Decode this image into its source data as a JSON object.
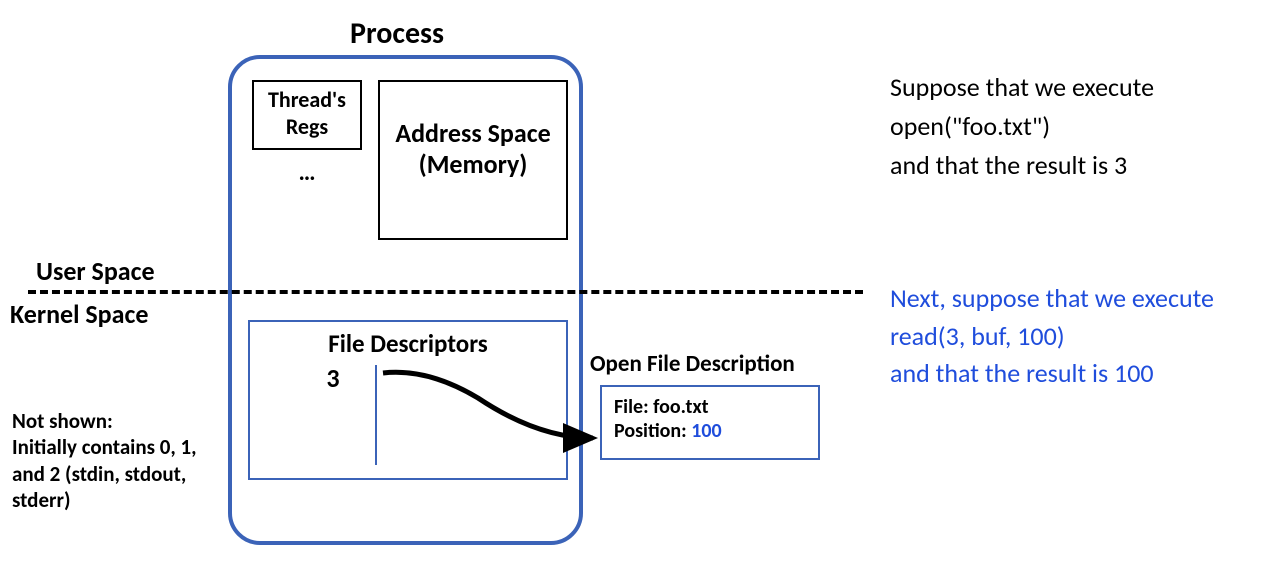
{
  "title": "Process",
  "labels": {
    "user_space": "User Space",
    "kernel_space": "Kernel Space",
    "thread_regs": "Thread's Regs",
    "thread_more": "…",
    "addr_space": "Address Space (Memory)",
    "file_descriptors": "File Descriptors",
    "fd_number": "3",
    "ofd_title": "Open File Description",
    "ofd_file_label": "File: ",
    "ofd_file_value": "foo.txt",
    "ofd_pos_label": "Position: ",
    "ofd_pos_value": "100"
  },
  "note": "Not shown:\nInitially contains 0, 1, and 2 (stdin, stdout, stderr)",
  "side1_line1": "Suppose that we execute",
  "side1_line2": "open(\"foo.txt\")",
  "side1_line3": "and that the result is 3",
  "side2_line1": "Next, suppose that we execute",
  "side2_line2": "read(3, buf, 100)",
  "side2_line3": "and that the result is 100"
}
